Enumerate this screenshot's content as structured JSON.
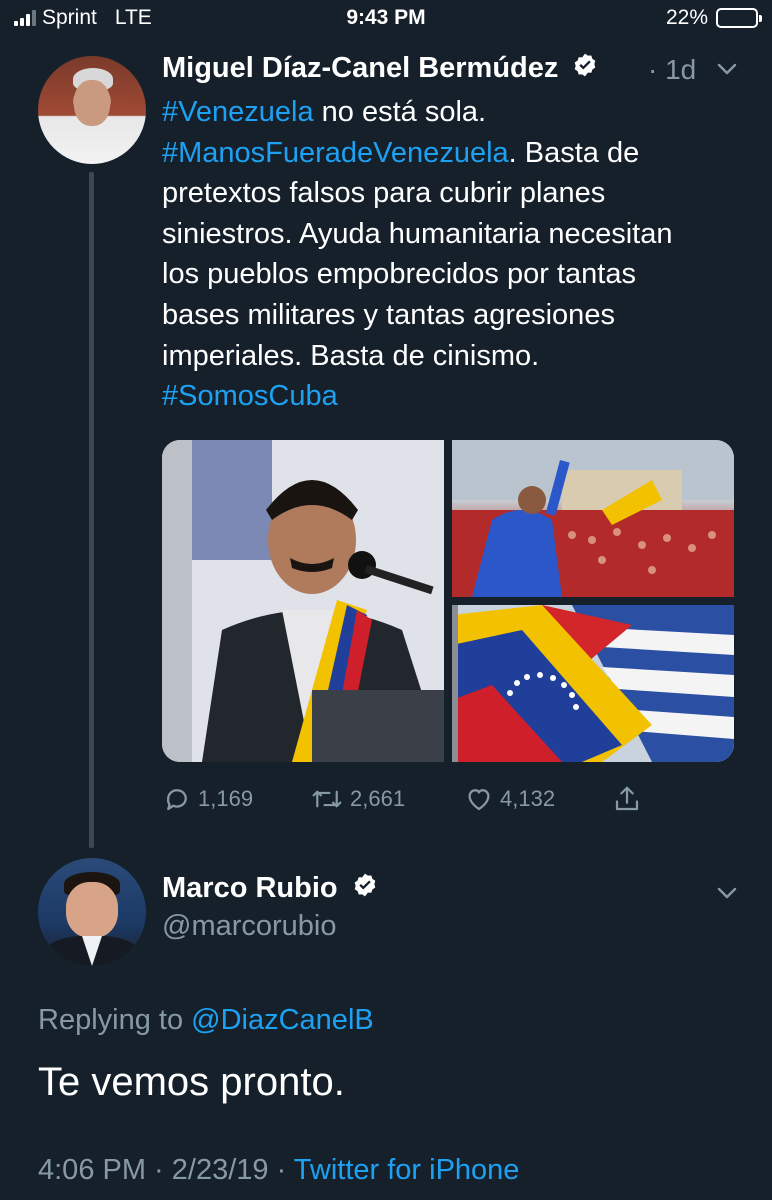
{
  "status_bar": {
    "carrier": "Sprint",
    "network": "LTE",
    "time": "9:43 PM",
    "battery_percent": "22%",
    "battery_level": 0.22
  },
  "tweet1": {
    "author_name": "Miguel Díaz-Canel Bermúdez",
    "age": "· 1d",
    "text_lines": [
      [
        {
          "t": "#Venezuela",
          "tag": true
        },
        {
          "t": " no está sola.",
          "tag": false
        }
      ],
      [
        {
          "t": "#ManosFueradeVenezuela",
          "tag": true
        },
        {
          "t": ". Basta de",
          "tag": false
        }
      ],
      [
        {
          "t": "pretextos falsos para cubrir planes",
          "tag": false
        }
      ],
      [
        {
          "t": "siniestros. Ayuda humanitaria necesitan",
          "tag": false
        }
      ],
      [
        {
          "t": "los pueblos empobrecidos por tantas",
          "tag": false
        }
      ],
      [
        {
          "t": "bases militares y tantas agresiones",
          "tag": false
        }
      ],
      [
        {
          "t": "imperiales. Basta de cinismo.",
          "tag": false
        }
      ],
      [
        {
          "t": "#SomosCuba",
          "tag": true
        }
      ]
    ],
    "actions": {
      "replies": "1,169",
      "retweets": "2,661",
      "likes": "4,132"
    }
  },
  "tweet2": {
    "author_name": "Marco Rubio",
    "handle": "@marcorubio",
    "replying_prefix": "Replying to ",
    "replying_to": "@DiazCanelB",
    "text": "Te vemos pronto.",
    "timestamp": "4:06 PM · 2/23/19 · ",
    "source": "Twitter for iPhone"
  },
  "colors": {
    "background": "#15202b",
    "link": "#1da1f2",
    "secondary_text": "#8899a6",
    "primary_text": "#ffffff"
  }
}
